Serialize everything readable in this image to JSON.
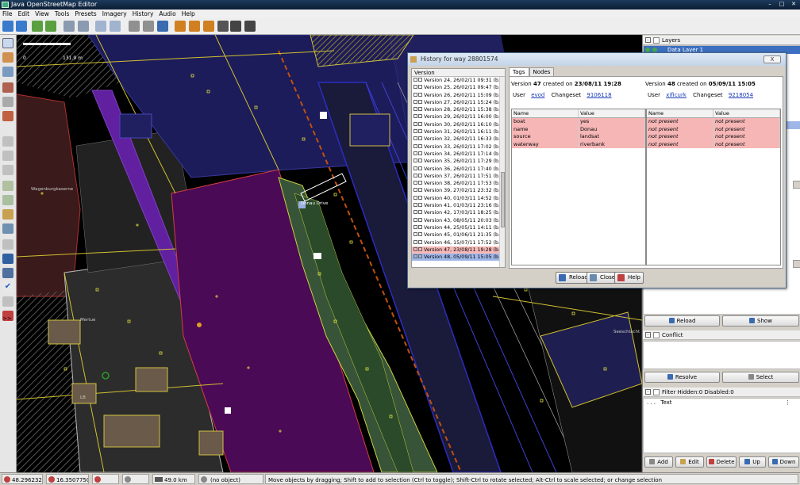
{
  "window": {
    "title": "Java OpenStreetMap Editor"
  },
  "menu": [
    "File",
    "Edit",
    "View",
    "Tools",
    "Presets",
    "Imagery",
    "History",
    "Audio",
    "Help"
  ],
  "map": {
    "scale_zero": "0",
    "scale_length": "131.9 m",
    "labels": {
      "street1": "Wagenburgkaserne",
      "street2": "Donau Drive",
      "street3": "Mertue",
      "street4": "Seeschlacht",
      "street5": "LB"
    }
  },
  "right_panel": {
    "layers_title": "Layers",
    "layer_name": "Data Layer 1",
    "reload_label": "Reload",
    "show_label": "Show",
    "conflict_title": "Conflict",
    "resolve_label": "Resolve",
    "select_label": "Select",
    "filter_title": "Filter Hidden:0 Disabled:0",
    "filter_row": "Text",
    "filter_dots": ". . .",
    "add_label": "Add",
    "edit_label": "Edit",
    "delete_label": "Delete",
    "up_label": "Up",
    "down_label": "Down"
  },
  "dialog": {
    "title": "History for way 28801574",
    "close_x": "X",
    "list_header": "Version",
    "versions": [
      "Version 24, 26/02/11 09:31 (b...",
      "Version 25, 26/02/11 09:47 (b...",
      "Version 26, 26/02/11 15:09 (b...",
      "Version 27, 26/02/11 15:24 (b...",
      "Version 28, 26/02/11 15:38 (b...",
      "Version 29, 26/02/11 16:00 (b...",
      "Version 30, 26/02/11 16:10 (b...",
      "Version 31, 26/02/11 16:11 (b...",
      "Version 32, 26/02/11 16:33 (b...",
      "Version 33, 26/02/11 17:02 (b...",
      "Version 34, 26/02/11 17:14 (b...",
      "Version 35, 26/02/11 17:29 (b...",
      "Version 36, 26/02/11 17:40 (b...",
      "Version 37, 26/02/11 17:51 (b...",
      "Version 38, 26/02/11 17:53 (b...",
      "Version 39, 27/02/11 23:32 (b...",
      "Version 40, 01/03/11 14:52 (b...",
      "Version 41, 01/03/11 23:16 (b...",
      "Version 42, 17/03/11 18:25 (b...",
      "Version 43, 08/05/11 20:03 (b...",
      "Version 44, 25/05/11 14:11 (b...",
      "Version 45, 01/06/11 21:35 (b...",
      "Version 46, 15/07/11 17:52 (b...",
      "Version 47, 23/08/11 19:28 (b...",
      "Version 48, 05/09/11 15:05 (b..."
    ],
    "tabs": [
      "Tags",
      "Nodes"
    ],
    "left": {
      "version_prefix": "Version ",
      "version_num": "47",
      "created_on": " created on ",
      "date": "23/08/11 19:28",
      "user_label": "User",
      "user": "evod",
      "changeset_label": "Changeset",
      "changeset": "9106118",
      "col_name": "Name",
      "col_value": "Value",
      "rows": [
        {
          "name": "boat",
          "value": "yes"
        },
        {
          "name": "name",
          "value": "Donau"
        },
        {
          "name": "source",
          "value": "landsat"
        },
        {
          "name": "waterway",
          "value": "riverbank"
        }
      ]
    },
    "right": {
      "version_prefix": "Version ",
      "version_num": "48",
      "created_on": " created on ",
      "date": "05/09/11 15:05",
      "user_label": "User",
      "user": "xificurk",
      "changeset_label": "Changeset",
      "changeset": "9218054",
      "col_name": "Name",
      "col_value": "Value",
      "rows": [
        {
          "name": "not present",
          "value": "not present"
        },
        {
          "name": "not present",
          "value": "not present"
        },
        {
          "name": "not present",
          "value": "not present"
        },
        {
          "name": "not present",
          "value": "not present"
        }
      ]
    },
    "buttons": {
      "reload": "Reload",
      "close": "Close",
      "help": "Help"
    }
  },
  "status": {
    "lat": "48.2962324",
    "lon": "16.3507750",
    "heading": "",
    "angle": "",
    "distance": "49.0 km",
    "selection": "(no object)",
    "message": "Move objects by dragging; Shift to add to selection (Ctrl to toggle); Shift-Ctrl to rotate selected; Alt-Ctrl to scale selected; or change selection"
  },
  "colors": {
    "titlebar": "#0c1e34",
    "map_bg": "#000000",
    "water_purple": "#3a0a4a",
    "selection_red": "#f5b8b8",
    "selection_blue": "#9fb6e8",
    "link": "#1a3ab8"
  }
}
